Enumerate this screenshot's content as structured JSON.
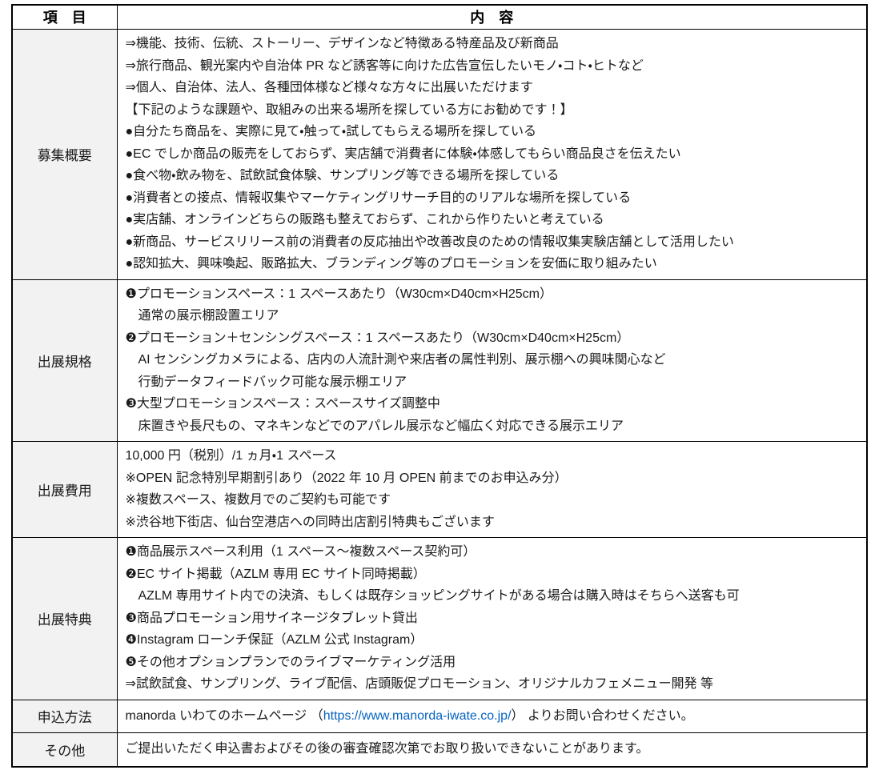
{
  "table": {
    "header": {
      "item": "項　目",
      "content": "内　容"
    },
    "rows": [
      {
        "label": "募集概要",
        "lines": [
          "⇒機能、技術、伝統、ストーリー、デザインなど特徴ある特産品及び新商品",
          "⇒旅行商品、観光案内や自治体 PR など誘客等に向けた広告宣伝したいモノ・コト・ヒトなど",
          "⇒個人、自治体、法人、各種団体様など様々な方々に出展いただけます",
          "【下記のような課題や、取組みの出来る場所を探している方にお勧めです！】",
          "●自分たち商品を、実際に見て・触って・試してもらえる場所を探している",
          "●EC でしか商品の販売をしておらず、実店舗で消費者に体験・体感してもらい商品良さを伝えたい",
          "●食べ物・飲み物を、試飲試食体験、サンプリング等できる場所を探している",
          "●消費者との接点、情報収集やマーケティングリサーチ目的のリアルな場所を探している",
          "●実店舗、オンラインどちらの販路も整えておらず、これから作りたいと考えている",
          "●新商品、サービスリリース前の消費者の反応抽出や改善改良のための情報収集実験店舗として活用したい",
          "●認知拡大、興味喚起、販路拡大、ブランディング等のプロモーションを安価に取り組みたい"
        ]
      },
      {
        "label": "出展規格",
        "lines": [
          "❶プロモーションスペース：1 スペースあたり（W30cm×D40cm×H25cm）",
          "　通常の展示棚設置エリア",
          "❷プロモーション＋センシングスペース：1 スペースあたり（W30cm×D40cm×H25cm）",
          "　AI センシングカメラによる、店内の人流計測や来店者の属性判別、展示棚への興味関心など",
          "　行動データフィードバック可能な展示棚エリア",
          "❸大型プロモーションスペース：スペースサイズ調整中",
          "　床置きや長尺もの、マネキンなどでのアパレル展示など幅広く対応できる展示エリア"
        ]
      },
      {
        "label": "出展費用",
        "lines": [
          "10,000 円（税別）/1 ヵ月・1 スペース",
          "※OPEN 記念特別早期割引あり（2022 年 10 月 OPEN 前までのお申込み分）",
          "※複数スペース、複数月でのご契約も可能です",
          "※渋谷地下街店、仙台空港店への同時出店割引特典もございます"
        ]
      },
      {
        "label": "出展特典",
        "lines": [
          "❶商品展示スペース利用（1 スペース～複数スペース契約可）",
          "❷EC サイト掲載（AZLM 専用 EC サイト同時掲載）",
          "　AZLM 専用サイト内での決済、もしくは既存ショッピングサイトがある場合は購入時はそちらへ送客も可",
          "❸商品プロモーション用サイネージタブレット貸出",
          "❹Instagram ローンチ保証（AZLM 公式 Instagram）",
          "❺その他オプションプランでのライブマーケティング活用",
          "⇒試飲試食、サンプリング、ライブ配信、店頭販促プロモーション、オリジナルカフェメニュー開発 等"
        ]
      },
      {
        "label": "申込方法",
        "parts": {
          "before": "manorda いわてのホームページ （",
          "link": "https://www.manorda-iwate.co.jp/",
          "after": "） よりお問い合わせください。"
        }
      },
      {
        "label": "その他",
        "lines": [
          "ご提出いただく申込書およびその後の審査確認次第でお取り扱いできないことがあります。"
        ]
      }
    ]
  },
  "colors": {
    "link_blue": "#0563c1",
    "label_background": "#f2f2f2",
    "border_black": "#000000"
  }
}
